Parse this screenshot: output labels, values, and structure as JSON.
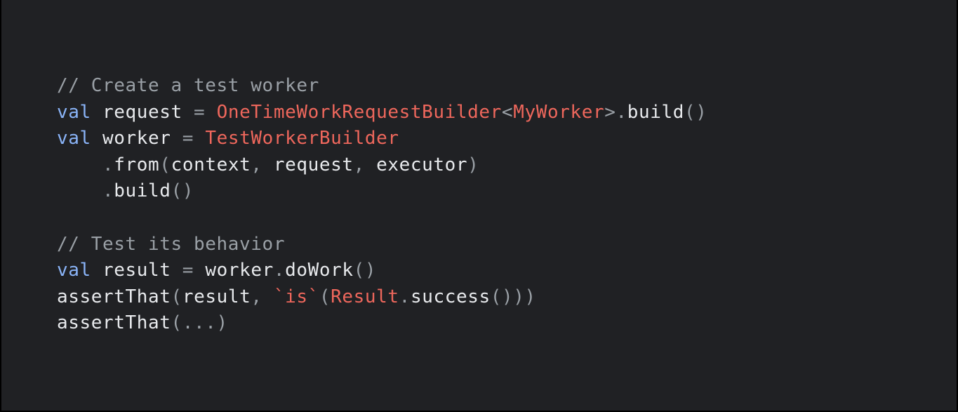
{
  "colors": {
    "page_background": "#000000",
    "slide_background": "#202124",
    "plain_text": "#e8eaed",
    "comment": "#9aa0a6",
    "keyword": "#8ab4f8",
    "type_and_string": "#ee675c",
    "punctuation": "#9aa0a6"
  },
  "code": {
    "language": "kotlin",
    "lines": [
      {
        "tokens": [
          {
            "kind": "comment",
            "text": "// Create a test worker"
          }
        ]
      },
      {
        "tokens": [
          {
            "kind": "keyword",
            "text": "val"
          },
          {
            "kind": "plain",
            "text": " request "
          },
          {
            "kind": "punct",
            "text": "="
          },
          {
            "kind": "plain",
            "text": " "
          },
          {
            "kind": "type",
            "text": "OneTimeWorkRequestBuilder"
          },
          {
            "kind": "punct",
            "text": "<"
          },
          {
            "kind": "type",
            "text": "MyWorker"
          },
          {
            "kind": "punct",
            "text": ">."
          },
          {
            "kind": "plain",
            "text": "build"
          },
          {
            "kind": "punct",
            "text": "()"
          }
        ]
      },
      {
        "tokens": [
          {
            "kind": "keyword",
            "text": "val"
          },
          {
            "kind": "plain",
            "text": " worker "
          },
          {
            "kind": "punct",
            "text": "="
          },
          {
            "kind": "plain",
            "text": " "
          },
          {
            "kind": "type",
            "text": "TestWorkerBuilder"
          }
        ]
      },
      {
        "tokens": [
          {
            "kind": "plain",
            "text": "    "
          },
          {
            "kind": "punct",
            "text": "."
          },
          {
            "kind": "plain",
            "text": "from"
          },
          {
            "kind": "punct",
            "text": "("
          },
          {
            "kind": "plain",
            "text": "context"
          },
          {
            "kind": "punct",
            "text": ", "
          },
          {
            "kind": "plain",
            "text": "request"
          },
          {
            "kind": "punct",
            "text": ", "
          },
          {
            "kind": "plain",
            "text": "executor"
          },
          {
            "kind": "punct",
            "text": ")"
          }
        ]
      },
      {
        "tokens": [
          {
            "kind": "plain",
            "text": "    "
          },
          {
            "kind": "punct",
            "text": "."
          },
          {
            "kind": "plain",
            "text": "build"
          },
          {
            "kind": "punct",
            "text": "()"
          }
        ]
      },
      {
        "tokens": []
      },
      {
        "tokens": [
          {
            "kind": "comment",
            "text": "// Test its behavior"
          }
        ]
      },
      {
        "tokens": [
          {
            "kind": "keyword",
            "text": "val"
          },
          {
            "kind": "plain",
            "text": " result "
          },
          {
            "kind": "punct",
            "text": "="
          },
          {
            "kind": "plain",
            "text": " worker"
          },
          {
            "kind": "punct",
            "text": "."
          },
          {
            "kind": "plain",
            "text": "doWork"
          },
          {
            "kind": "punct",
            "text": "()"
          }
        ]
      },
      {
        "tokens": [
          {
            "kind": "plain",
            "text": "assertThat"
          },
          {
            "kind": "punct",
            "text": "("
          },
          {
            "kind": "plain",
            "text": "result"
          },
          {
            "kind": "punct",
            "text": ", "
          },
          {
            "kind": "type",
            "text": "`is`"
          },
          {
            "kind": "punct",
            "text": "("
          },
          {
            "kind": "type",
            "text": "Result"
          },
          {
            "kind": "punct",
            "text": "."
          },
          {
            "kind": "plain",
            "text": "success"
          },
          {
            "kind": "punct",
            "text": "()))"
          }
        ]
      },
      {
        "tokens": [
          {
            "kind": "plain",
            "text": "assertThat"
          },
          {
            "kind": "punct",
            "text": "(...)"
          }
        ]
      }
    ]
  }
}
